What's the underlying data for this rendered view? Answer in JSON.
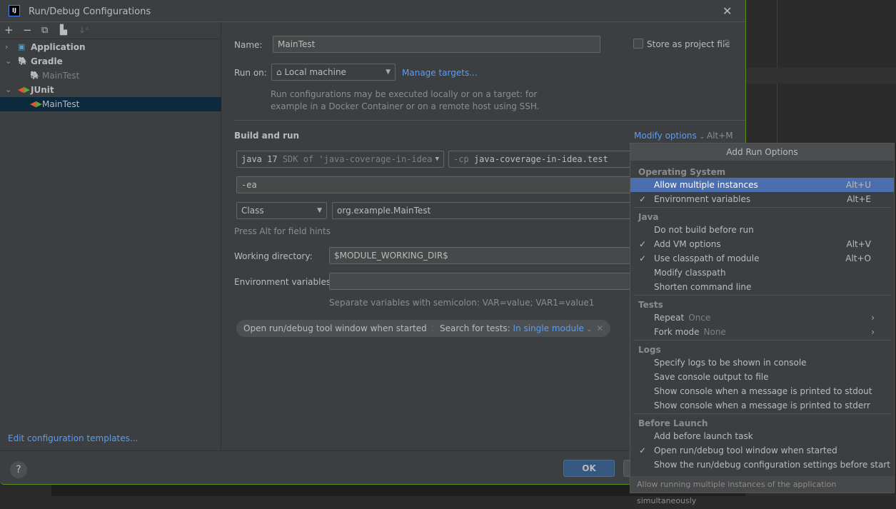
{
  "window": {
    "title": "Run/Debug Configurations",
    "logo": "IJ"
  },
  "toolbar": {
    "icons": [
      "add-icon",
      "remove-icon",
      "copy-icon",
      "new-folder-icon",
      "sort-icon"
    ]
  },
  "tree": [
    {
      "label": "Application",
      "icon": "application-icon",
      "expanded": false
    },
    {
      "label": "Gradle",
      "icon": "gradle-icon",
      "expanded": true
    },
    {
      "label": "MainTest",
      "icon": "gradle-icon",
      "child": true
    },
    {
      "label": "JUnit",
      "icon": "junit-icon",
      "expanded": true
    },
    {
      "label": "MainTest",
      "icon": "junit-icon",
      "child": true,
      "selected": true
    }
  ],
  "edit_templates": "Edit configuration templates...",
  "form": {
    "name_label": "Name:",
    "name_value": "MainTest",
    "store_label": "Store as project file",
    "store_checked": false,
    "run_on_label": "Run on:",
    "run_on_value": "Local machine",
    "manage_targets": "Manage targets...",
    "run_on_hint_1": "Run configurations may be executed locally or on a target: for",
    "run_on_hint_2": "example in a Docker Container or on a remote host using SSH.",
    "build_run": "Build and run",
    "modify_options": "Modify options",
    "modify_shortcut": "Alt+M",
    "jdk_main": "java 17",
    "jdk_detail": "SDK of 'java-coverage-in-idea",
    "cp_prefix": "-cp",
    "cp_value": "java-coverage-in-idea.test",
    "vm_options": "-ea",
    "kind": "Class",
    "class_value": "org.example.MainTest",
    "alt_hint": "Press Alt for field hints",
    "workdir_label": "Working directory:",
    "workdir_value": "$MODULE_WORKING_DIR$",
    "env_label": "Environment variables:",
    "env_value": "",
    "env_hint": "Separate variables with semicolon: VAR=value; VAR1=value1",
    "chip1": "Open run/debug tool window when started",
    "chip2_label": "Search for tests:",
    "chip2_value": "In single module"
  },
  "footer": {
    "help": "?",
    "ok": "OK"
  },
  "menu": {
    "title": "Add Run Options",
    "groups": [
      {
        "name": "Operating System",
        "items": [
          {
            "label": "Allow multiple instances",
            "shortcut": "Alt+U",
            "checked": false,
            "highlighted": true
          },
          {
            "label": "Environment variables",
            "shortcut": "Alt+E",
            "checked": true
          }
        ]
      },
      {
        "name": "Java",
        "items": [
          {
            "label": "Do not build before run"
          },
          {
            "label": "Add VM options",
            "shortcut": "Alt+V",
            "checked": true
          },
          {
            "label": "Use classpath of module",
            "shortcut": "Alt+O",
            "checked": true
          },
          {
            "label": "Modify classpath"
          },
          {
            "label": "Shorten command line"
          }
        ]
      },
      {
        "name": "Tests",
        "items": [
          {
            "label": "Repeat",
            "value": "Once",
            "submenu": true
          },
          {
            "label": "Fork mode",
            "value": "None",
            "submenu": true
          }
        ]
      },
      {
        "name": "Logs",
        "items": [
          {
            "label": "Specify logs to be shown in console"
          },
          {
            "label": "Save console output to file"
          },
          {
            "label": "Show console when a message is printed to stdout"
          },
          {
            "label": "Show console when a message is printed to stderr"
          }
        ]
      },
      {
        "name": "Before Launch",
        "items": [
          {
            "label": "Add before launch task"
          },
          {
            "label": "Open run/debug tool window when started",
            "checked": true
          },
          {
            "label": "Show the run/debug configuration settings before start"
          }
        ]
      }
    ],
    "footer": "Allow running multiple instances of the application simultaneously"
  }
}
